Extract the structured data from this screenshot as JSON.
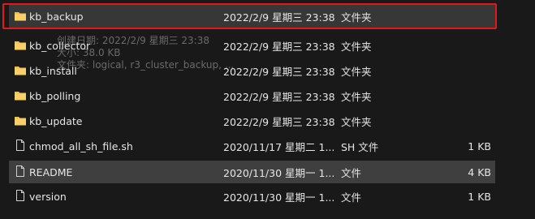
{
  "rows": [
    {
      "name": "kb_backup",
      "date": "2022/2/9 星期三 23:38",
      "type": "文件夹",
      "size": "",
      "icon": "folder-icon"
    },
    {
      "name": "kb_collector",
      "date": "2022/2/9 星期三 23:38",
      "type": "文件夹",
      "size": "",
      "icon": "folder-icon"
    },
    {
      "name": "kb_install",
      "date": "2022/2/9 星期三 23:38",
      "type": "文件夹",
      "size": "",
      "icon": "folder-icon"
    },
    {
      "name": "kb_polling",
      "date": "2022/2/9 星期三 23:38",
      "type": "文件夹",
      "size": "",
      "icon": "folder-icon"
    },
    {
      "name": "kb_update",
      "date": "2022/2/9 星期三 23:38",
      "type": "文件夹",
      "size": "",
      "icon": "folder-icon"
    },
    {
      "name": "chmod_all_sh_file.sh",
      "date": "2020/11/17 星期二 1...",
      "type": "SH 文件",
      "size": "1 KB",
      "icon": "file-icon"
    },
    {
      "name": "README",
      "date": "2020/11/30 星期一 1...",
      "type": "文件",
      "size": "4 KB",
      "icon": "file-icon"
    },
    {
      "name": "version",
      "date": "2020/11/30 星期一 1...",
      "type": "文件",
      "size": "1 KB",
      "icon": "file-icon"
    }
  ],
  "tooltip": {
    "line1": "创建日期: 2022/2/9 星期三 23:38",
    "line2": "大小: 38.0 KB",
    "line3": "文件夹: logical, r3_cluster_backup, ..."
  },
  "colors": {
    "background": "#191919",
    "selected_row": "#373737",
    "hover_row": "#3f3f3f",
    "focus_outline": "#e01a1a",
    "folder": "#f2c14e"
  }
}
